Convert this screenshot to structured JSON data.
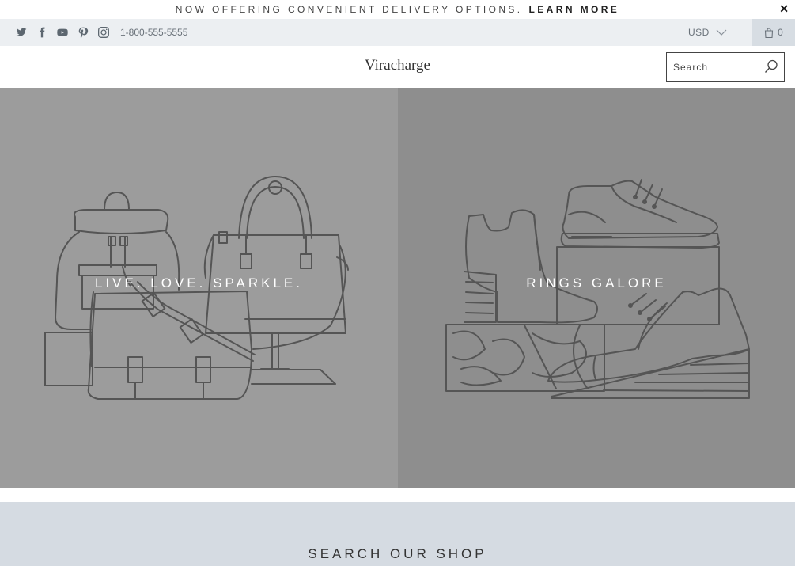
{
  "announcement": {
    "text": "NOW OFFERING CONVENIENT DELIVERY OPTIONS.",
    "link": "LEARN MORE",
    "close_icon": "close-icon"
  },
  "utility_bar": {
    "social_icons": [
      "twitter-icon",
      "facebook-icon",
      "youtube-icon",
      "pinterest-icon",
      "instagram-icon"
    ],
    "phone": "1-800-555-5555",
    "currency": "USD",
    "cart_count": "0"
  },
  "header": {
    "logo": "Viracharge",
    "search_placeholder": "Search"
  },
  "hero": {
    "left_title": "LIVE. LOVE. SPARKLE.",
    "right_title": "RINGS GALORE"
  },
  "shop_search": {
    "title": "SEARCH OUR SHOP"
  },
  "colors": {
    "utility_bg": "#eceff2",
    "cart_bg": "#d7dde3",
    "panel_left": "#9c9c9c",
    "panel_right": "#8e8e8e",
    "shop_search_bg": "#d5dbe2"
  }
}
